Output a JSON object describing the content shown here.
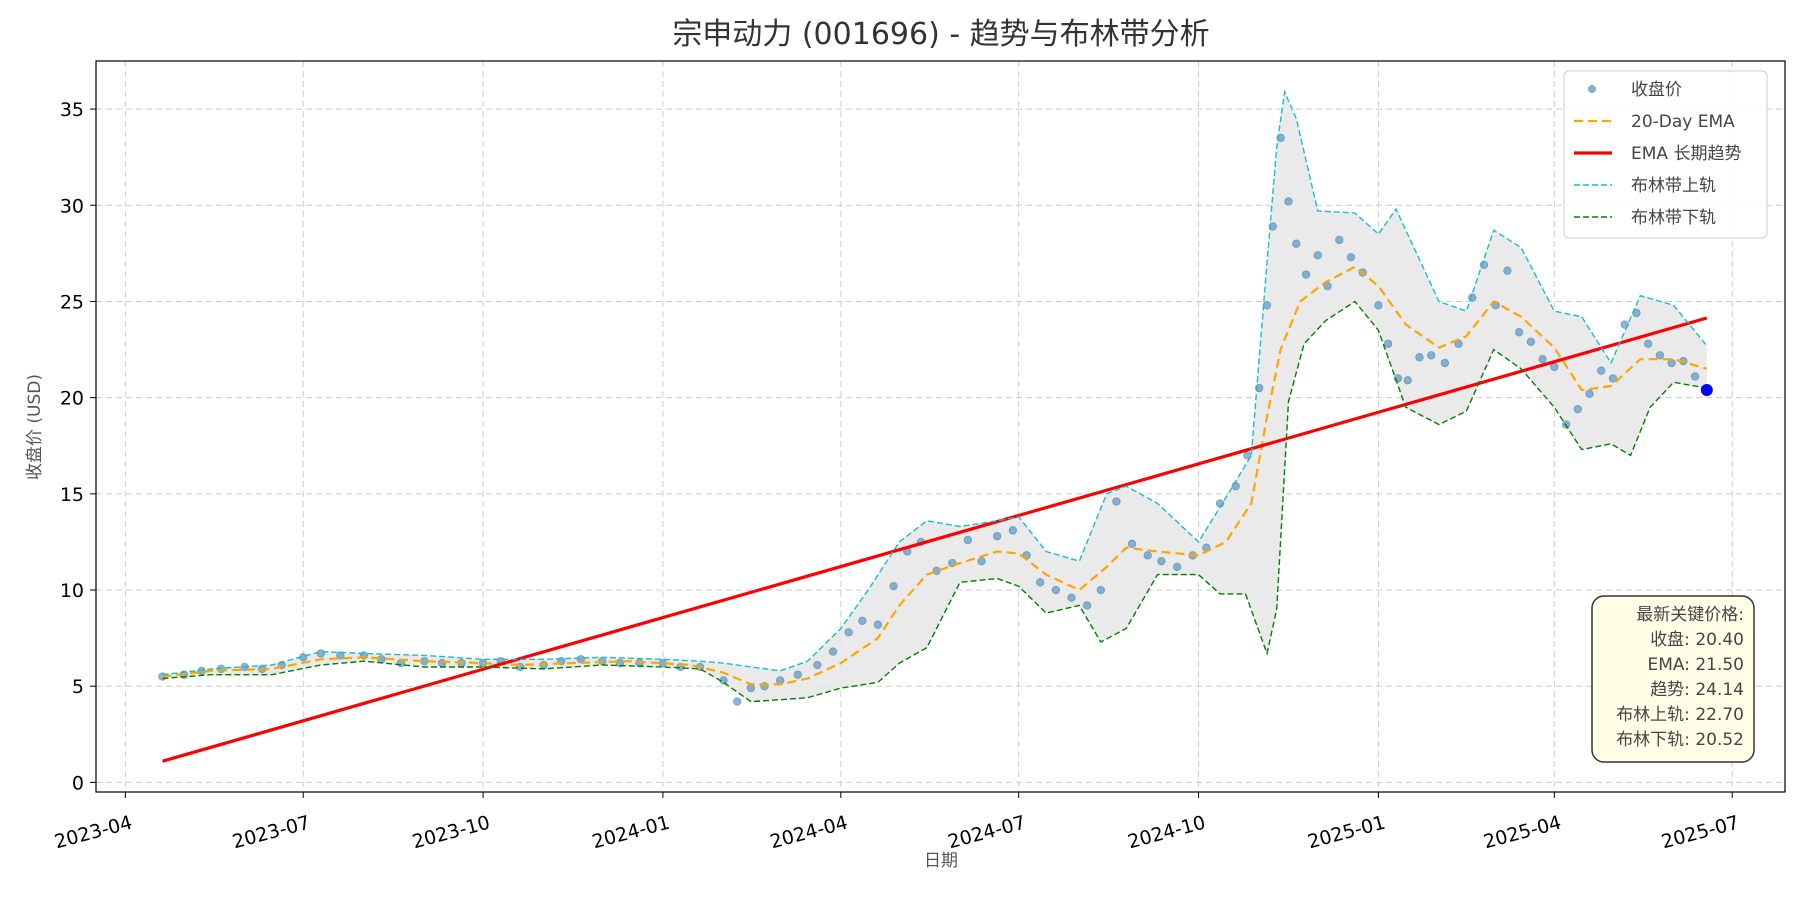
{
  "chart_data": {
    "type": "line",
    "title": "宗申动力 (001696) - 趋势与布林带分析",
    "xlabel": "日期",
    "ylabel": "收盘价 (USD)",
    "xlim": [
      "2023-03-17",
      "2025-07-28"
    ],
    "ylim": [
      -0.5,
      37.5
    ],
    "x_ticks": [
      "2023-04",
      "2023-07",
      "2023-10",
      "2024-01",
      "2024-04",
      "2024-07",
      "2024-10",
      "2025-01",
      "2025-04",
      "2025-07"
    ],
    "y_ticks": [
      0,
      5,
      10,
      15,
      20,
      25,
      30,
      35
    ],
    "grid": true,
    "legend_position": "top-right",
    "legend": [
      "收盘价",
      "20-Day EMA",
      "EMA 长期趋势",
      "布林带上轨",
      "布林带下轨"
    ],
    "colors": {
      "close": "#4f8fbf",
      "ema": "#ffa500",
      "trend": "#ff0000",
      "upper": "#17becf",
      "lower": "#008000",
      "band_fill": "#e8e8e8",
      "last_point": "#0000ff"
    },
    "series": [
      {
        "name": "收盘价",
        "kind": "scatter",
        "points": [
          [
            "2023-04-20",
            5.5
          ],
          [
            "2023-05-01",
            5.6
          ],
          [
            "2023-05-10",
            5.8
          ],
          [
            "2023-05-20",
            5.9
          ],
          [
            "2023-06-01",
            6.0
          ],
          [
            "2023-06-10",
            5.9
          ],
          [
            "2023-06-20",
            6.1
          ],
          [
            "2023-07-01",
            6.5
          ],
          [
            "2023-07-10",
            6.7
          ],
          [
            "2023-07-20",
            6.6
          ],
          [
            "2023-08-01",
            6.6
          ],
          [
            "2023-08-10",
            6.4
          ],
          [
            "2023-08-20",
            6.2
          ],
          [
            "2023-09-01",
            6.3
          ],
          [
            "2023-09-10",
            6.2
          ],
          [
            "2023-09-20",
            6.2
          ],
          [
            "2023-10-01",
            6.2
          ],
          [
            "2023-10-10",
            6.3
          ],
          [
            "2023-10-20",
            6.0
          ],
          [
            "2023-11-01",
            6.1
          ],
          [
            "2023-11-10",
            6.3
          ],
          [
            "2023-11-20",
            6.4
          ],
          [
            "2023-12-01",
            6.3
          ],
          [
            "2023-12-10",
            6.2
          ],
          [
            "2023-12-20",
            6.2
          ],
          [
            "2024-01-01",
            6.2
          ],
          [
            "2024-01-10",
            6.0
          ],
          [
            "2024-01-20",
            6.0
          ],
          [
            "2024-02-01",
            5.3
          ],
          [
            "2024-02-08",
            4.2
          ],
          [
            "2024-02-15",
            4.9
          ],
          [
            "2024-02-22",
            5.0
          ],
          [
            "2024-03-01",
            5.3
          ],
          [
            "2024-03-10",
            5.6
          ],
          [
            "2024-03-20",
            6.1
          ],
          [
            "2024-03-28",
            6.8
          ],
          [
            "2024-04-05",
            7.8
          ],
          [
            "2024-04-12",
            8.4
          ],
          [
            "2024-04-20",
            8.2
          ],
          [
            "2024-04-28",
            10.2
          ],
          [
            "2024-05-05",
            12.0
          ],
          [
            "2024-05-12",
            12.5
          ],
          [
            "2024-05-20",
            11.0
          ],
          [
            "2024-05-28",
            11.4
          ],
          [
            "2024-06-05",
            12.6
          ],
          [
            "2024-06-12",
            11.5
          ],
          [
            "2024-06-20",
            12.8
          ],
          [
            "2024-06-28",
            13.1
          ],
          [
            "2024-07-05",
            11.8
          ],
          [
            "2024-07-12",
            10.4
          ],
          [
            "2024-07-20",
            10.0
          ],
          [
            "2024-07-28",
            9.6
          ],
          [
            "2024-08-05",
            9.2
          ],
          [
            "2024-08-12",
            10.0
          ],
          [
            "2024-08-20",
            14.6
          ],
          [
            "2024-08-28",
            12.4
          ],
          [
            "2024-09-05",
            11.8
          ],
          [
            "2024-09-12",
            11.5
          ],
          [
            "2024-09-20",
            11.2
          ],
          [
            "2024-09-28",
            11.8
          ],
          [
            "2024-10-05",
            12.2
          ],
          [
            "2024-10-12",
            14.5
          ],
          [
            "2024-10-20",
            15.4
          ],
          [
            "2024-10-26",
            17.0
          ],
          [
            "2024-11-01",
            20.5
          ],
          [
            "2024-11-05",
            24.8
          ],
          [
            "2024-11-08",
            28.9
          ],
          [
            "2024-11-12",
            33.5
          ],
          [
            "2024-11-16",
            30.2
          ],
          [
            "2024-11-20",
            28.0
          ],
          [
            "2024-11-25",
            26.4
          ],
          [
            "2024-12-01",
            27.4
          ],
          [
            "2024-12-06",
            25.8
          ],
          [
            "2024-12-12",
            28.2
          ],
          [
            "2024-12-18",
            27.3
          ],
          [
            "2024-12-24",
            26.5
          ],
          [
            "2025-01-01",
            24.8
          ],
          [
            "2025-01-06",
            22.8
          ],
          [
            "2025-01-11",
            21.0
          ],
          [
            "2025-01-16",
            20.9
          ],
          [
            "2025-01-22",
            22.1
          ],
          [
            "2025-01-28",
            22.2
          ],
          [
            "2025-02-04",
            21.8
          ],
          [
            "2025-02-11",
            22.8
          ],
          [
            "2025-02-18",
            25.2
          ],
          [
            "2025-02-24",
            26.9
          ],
          [
            "2025-03-02",
            24.8
          ],
          [
            "2025-03-08",
            26.6
          ],
          [
            "2025-03-14",
            23.4
          ],
          [
            "2025-03-20",
            22.9
          ],
          [
            "2025-03-26",
            22.0
          ],
          [
            "2025-04-01",
            21.6
          ],
          [
            "2025-04-07",
            18.6
          ],
          [
            "2025-04-13",
            19.4
          ],
          [
            "2025-04-19",
            20.2
          ],
          [
            "2025-04-25",
            21.4
          ],
          [
            "2025-05-01",
            21.0
          ],
          [
            "2025-05-07",
            23.8
          ],
          [
            "2025-05-13",
            24.4
          ],
          [
            "2025-05-19",
            22.8
          ],
          [
            "2025-05-25",
            22.2
          ],
          [
            "2025-05-31",
            21.8
          ],
          [
            "2025-06-06",
            21.9
          ],
          [
            "2025-06-12",
            21.1
          ],
          [
            "2025-06-18",
            20.4
          ]
        ]
      },
      {
        "name": "20-Day EMA",
        "kind": "line",
        "points": [
          [
            "2023-04-20",
            5.5
          ],
          [
            "2023-05-15",
            5.8
          ],
          [
            "2023-06-15",
            5.9
          ],
          [
            "2023-07-10",
            6.4
          ],
          [
            "2023-08-01",
            6.5
          ],
          [
            "2023-09-01",
            6.3
          ],
          [
            "2023-10-01",
            6.2
          ],
          [
            "2023-10-20",
            6.1
          ],
          [
            "2023-11-15",
            6.2
          ],
          [
            "2023-12-15",
            6.3
          ],
          [
            "2024-01-15",
            6.1
          ],
          [
            "2024-02-01",
            5.7
          ],
          [
            "2024-02-15",
            5.1
          ],
          [
            "2024-03-01",
            5.1
          ],
          [
            "2024-03-15",
            5.4
          ],
          [
            "2024-04-01",
            6.2
          ],
          [
            "2024-04-20",
            7.5
          ],
          [
            "2024-05-01",
            9.2
          ],
          [
            "2024-05-15",
            10.8
          ],
          [
            "2024-06-01",
            11.4
          ],
          [
            "2024-06-20",
            12.0
          ],
          [
            "2024-07-01",
            11.9
          ],
          [
            "2024-07-15",
            10.8
          ],
          [
            "2024-08-01",
            10.0
          ],
          [
            "2024-08-15",
            11.2
          ],
          [
            "2024-08-25",
            12.2
          ],
          [
            "2024-09-10",
            12.0
          ],
          [
            "2024-10-01",
            11.8
          ],
          [
            "2024-10-15",
            12.5
          ],
          [
            "2024-10-28",
            14.5
          ],
          [
            "2024-11-05",
            19.0
          ],
          [
            "2024-11-12",
            22.5
          ],
          [
            "2024-11-22",
            25.0
          ],
          [
            "2024-12-05",
            26.0
          ],
          [
            "2024-12-20",
            26.8
          ],
          [
            "2025-01-01",
            25.8
          ],
          [
            "2025-01-15",
            23.8
          ],
          [
            "2025-02-01",
            22.6
          ],
          [
            "2025-02-15",
            23.2
          ],
          [
            "2025-03-01",
            25.0
          ],
          [
            "2025-03-15",
            24.2
          ],
          [
            "2025-04-01",
            22.6
          ],
          [
            "2025-04-15",
            20.4
          ],
          [
            "2025-04-30",
            20.6
          ],
          [
            "2025-05-15",
            22.0
          ],
          [
            "2025-06-01",
            22.0
          ],
          [
            "2025-06-18",
            21.5
          ]
        ]
      },
      {
        "name": "EMA 长期趋势",
        "kind": "line",
        "points": [
          [
            "2023-04-20",
            1.1
          ],
          [
            "2025-06-18",
            24.14
          ]
        ]
      },
      {
        "name": "布林带上轨",
        "kind": "line",
        "points": [
          [
            "2023-04-20",
            5.6
          ],
          [
            "2023-05-15",
            5.9
          ],
          [
            "2023-06-15",
            6.1
          ],
          [
            "2023-07-10",
            6.8
          ],
          [
            "2023-08-01",
            6.7
          ],
          [
            "2023-09-01",
            6.6
          ],
          [
            "2023-10-01",
            6.4
          ],
          [
            "2023-11-01",
            6.4
          ],
          [
            "2023-12-01",
            6.5
          ],
          [
            "2024-01-01",
            6.4
          ],
          [
            "2024-01-20",
            6.3
          ],
          [
            "2024-02-01",
            6.2
          ],
          [
            "2024-02-15",
            6.0
          ],
          [
            "2024-03-01",
            5.8
          ],
          [
            "2024-03-15",
            6.3
          ],
          [
            "2024-04-01",
            8.0
          ],
          [
            "2024-04-15",
            10.0
          ],
          [
            "2024-05-01",
            12.5
          ],
          [
            "2024-05-15",
            13.6
          ],
          [
            "2024-06-01",
            13.3
          ],
          [
            "2024-06-20",
            13.6
          ],
          [
            "2024-07-01",
            13.8
          ],
          [
            "2024-07-15",
            12.0
          ],
          [
            "2024-08-01",
            11.5
          ],
          [
            "2024-08-15",
            15.0
          ],
          [
            "2024-08-25",
            15.4
          ],
          [
            "2024-09-10",
            14.5
          ],
          [
            "2024-10-01",
            12.5
          ],
          [
            "2024-10-15",
            14.8
          ],
          [
            "2024-10-28",
            17.0
          ],
          [
            "2024-11-05",
            27.0
          ],
          [
            "2024-11-10",
            33.0
          ],
          [
            "2024-11-14",
            35.9
          ],
          [
            "2024-11-20",
            34.5
          ],
          [
            "2024-12-01",
            29.7
          ],
          [
            "2024-12-20",
            29.6
          ],
          [
            "2025-01-01",
            28.5
          ],
          [
            "2025-01-10",
            29.8
          ],
          [
            "2025-02-01",
            25.0
          ],
          [
            "2025-02-15",
            24.5
          ],
          [
            "2025-03-01",
            28.7
          ],
          [
            "2025-03-15",
            27.8
          ],
          [
            "2025-04-01",
            24.5
          ],
          [
            "2025-04-15",
            24.2
          ],
          [
            "2025-04-30",
            21.8
          ],
          [
            "2025-05-15",
            25.3
          ],
          [
            "2025-06-01",
            24.8
          ],
          [
            "2025-06-18",
            22.7
          ]
        ]
      },
      {
        "name": "布林带下轨",
        "kind": "line",
        "points": [
          [
            "2023-04-20",
            5.4
          ],
          [
            "2023-05-15",
            5.6
          ],
          [
            "2023-06-15",
            5.6
          ],
          [
            "2023-07-10",
            6.1
          ],
          [
            "2023-08-01",
            6.3
          ],
          [
            "2023-09-01",
            6.0
          ],
          [
            "2023-10-01",
            6.0
          ],
          [
            "2023-11-01",
            5.9
          ],
          [
            "2023-12-01",
            6.1
          ],
          [
            "2024-01-01",
            6.0
          ],
          [
            "2024-01-20",
            5.9
          ],
          [
            "2024-02-01",
            5.2
          ],
          [
            "2024-02-15",
            4.2
          ],
          [
            "2024-03-01",
            4.3
          ],
          [
            "2024-03-15",
            4.4
          ],
          [
            "2024-04-01",
            4.9
          ],
          [
            "2024-04-20",
            5.2
          ],
          [
            "2024-05-01",
            6.2
          ],
          [
            "2024-05-15",
            7.0
          ],
          [
            "2024-06-01",
            10.4
          ],
          [
            "2024-06-20",
            10.6
          ],
          [
            "2024-07-01",
            10.2
          ],
          [
            "2024-07-15",
            8.8
          ],
          [
            "2024-08-01",
            9.2
          ],
          [
            "2024-08-12",
            7.3
          ],
          [
            "2024-08-25",
            8.0
          ],
          [
            "2024-09-10",
            10.8
          ],
          [
            "2024-10-01",
            10.8
          ],
          [
            "2024-10-12",
            9.8
          ],
          [
            "2024-10-25",
            9.8
          ],
          [
            "2024-11-05",
            6.7
          ],
          [
            "2024-11-10",
            9.0
          ],
          [
            "2024-11-16",
            19.8
          ],
          [
            "2024-11-24",
            22.8
          ],
          [
            "2024-12-05",
            24.0
          ],
          [
            "2024-12-20",
            25.0
          ],
          [
            "2025-01-01",
            23.5
          ],
          [
            "2025-01-15",
            19.5
          ],
          [
            "2025-02-01",
            18.6
          ],
          [
            "2025-02-15",
            19.3
          ],
          [
            "2025-03-01",
            22.5
          ],
          [
            "2025-03-15",
            21.5
          ],
          [
            "2025-04-01",
            19.5
          ],
          [
            "2025-04-15",
            17.3
          ],
          [
            "2025-04-30",
            17.6
          ],
          [
            "2025-05-10",
            17.0
          ],
          [
            "2025-05-20",
            19.5
          ],
          [
            "2025-06-01",
            20.8
          ],
          [
            "2025-06-18",
            20.5
          ]
        ]
      }
    ],
    "last_point": [
      "2025-06-18",
      20.4
    ],
    "annotation": {
      "title": "最新关键价格:",
      "lines": [
        "收盘: 20.40",
        "EMA: 21.50",
        "趋势: 24.14",
        "布林上轨: 22.70",
        "布林下轨: 20.52"
      ]
    }
  }
}
